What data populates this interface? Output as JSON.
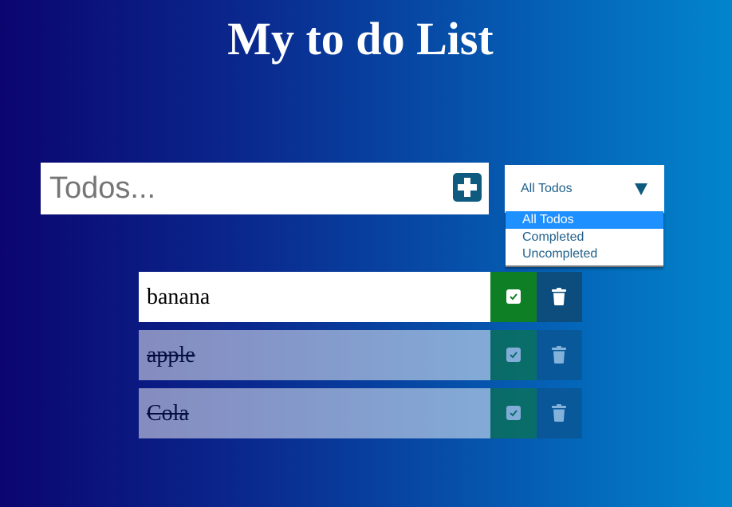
{
  "header": {
    "title": "My to do List"
  },
  "todo_input": {
    "placeholder": "Todos...",
    "value": ""
  },
  "add_button": {
    "icon": "plus-square-icon"
  },
  "filter": {
    "selected": "All Todos",
    "options": [
      "All Todos",
      "Completed",
      "Uncompleted"
    ],
    "highlighted_option": "All Todos",
    "open": true
  },
  "todos": [
    {
      "text": "banana",
      "completed": false
    },
    {
      "text": "apple",
      "completed": true
    },
    {
      "text": "Cola",
      "completed": true
    }
  ],
  "colors": {
    "check_button": "#0e7f24",
    "trash_button": "#0d4d7e",
    "accent": "#0f5b80",
    "highlight": "#1e90ff"
  }
}
